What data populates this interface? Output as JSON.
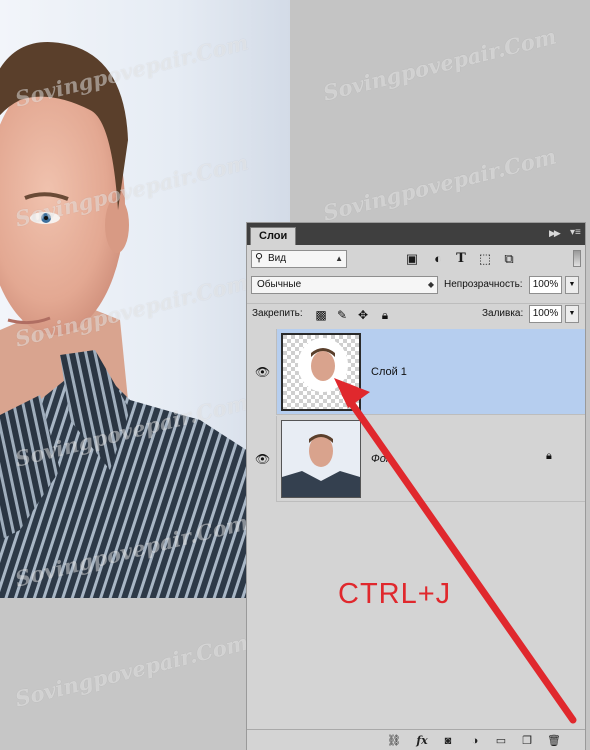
{
  "watermark": "Sovingpovepair.Com",
  "panel": {
    "tab_label": "Слои",
    "collapse_icon": "double-chevron-right",
    "menu_icon": "panel-menu",
    "filter": {
      "label": "Вид",
      "icons": [
        "image-filter-icon",
        "adjustment-filter-icon",
        "type-filter-icon",
        "shape-filter-icon",
        "smart-object-filter-icon"
      ]
    },
    "blend_mode": "Обычные",
    "opacity_label": "Непрозрачность:",
    "opacity_value": "100%",
    "lock_label": "Закрепить:",
    "fill_label": "Заливка:",
    "fill_value": "100%",
    "layers": [
      {
        "name": "Слой 1",
        "visible": true,
        "selected": true
      },
      {
        "name": "Фон",
        "visible": true,
        "locked": true
      }
    ],
    "bottom_icons": [
      "link-icon",
      "fx-icon",
      "mask-icon",
      "adjustment-icon",
      "folder-icon",
      "new-layer-icon",
      "trash-icon"
    ],
    "bottom_fx": "fx"
  },
  "annotation": {
    "text": "CTRL+J",
    "color": "#e0282d"
  },
  "colors": {
    "selected_layer": "#b6ceef",
    "panel_bg": "#d4d4d4",
    "panel_topbar": "#3f3f3f"
  }
}
